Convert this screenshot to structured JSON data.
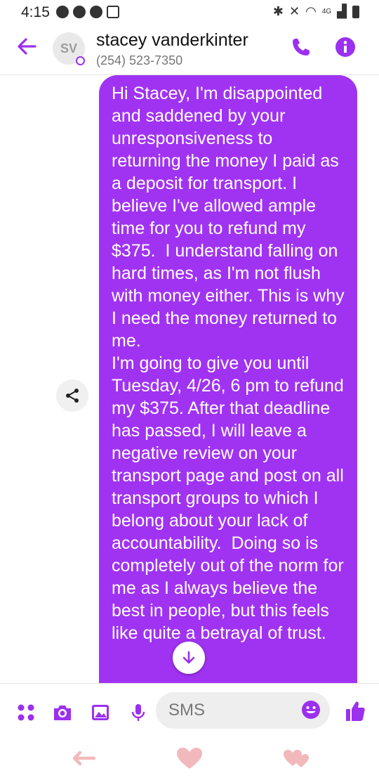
{
  "status_bar": {
    "time": "4:15",
    "network": "4G",
    "icons": [
      "bluetooth-icon",
      "mute-icon",
      "wifi-icon",
      "signal-icon",
      "battery-icon"
    ]
  },
  "header": {
    "avatar_initials": "SV",
    "contact_name": "stacey vanderkinter",
    "phone": "(254) 523-7350",
    "accent_color": "#9b30ef"
  },
  "message": {
    "text": "Hi Stacey, I'm disappointed and saddened by your unresponsiveness to returning the money I paid as a deposit for transport. I believe I've allowed ample time for you to refund my $375.  I understand falling on hard times, as I'm not flush with money either. This is why I need the money returned to me.\nI'm going to give you until Tuesday, 4/26, 6 pm to refund my $375. After that deadline has passed, I will leave a negative review on your transport page and post on all transport groups to which I belong about your lack of accountability.  Doing so is completely out of the norm for me as I always believe the best in people, but this feels like quite a betrayal of trust.",
    "bubble_color": "#a033f2"
  },
  "composer": {
    "placeholder": "SMS"
  }
}
